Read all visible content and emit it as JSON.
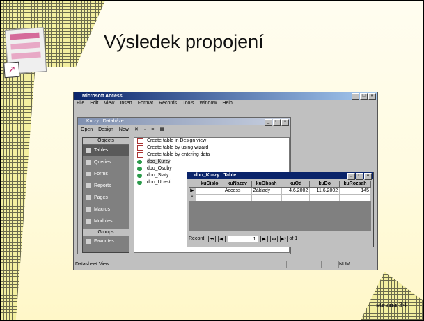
{
  "slide": {
    "title": "Výsledek propojení",
    "page_label": "strana 34",
    "icon_name": "access-logo-icon"
  },
  "access": {
    "app_title": "Microsoft Access",
    "menu": [
      "File",
      "Edit",
      "View",
      "Insert",
      "Format",
      "Records",
      "Tools",
      "Window",
      "Help"
    ],
    "db_window": {
      "title": "Kurzy : Databáze",
      "toolbar": {
        "open": "Open",
        "design": "Design",
        "new": "New"
      },
      "objects_header": "Objects",
      "objects": [
        "Tables",
        "Queries",
        "Forms",
        "Reports",
        "Pages",
        "Macros",
        "Modules"
      ],
      "selected_object": "Tables",
      "groups_header": "Groups",
      "groups": [
        "Favorites"
      ],
      "list": [
        {
          "label": "Create table in Design view",
          "kind": "wizard"
        },
        {
          "label": "Create table by using wizard",
          "kind": "wizard"
        },
        {
          "label": "Create table by entering data",
          "kind": "wizard"
        },
        {
          "label": "dbo_Kurzy",
          "kind": "table"
        },
        {
          "label": "dbo_Osoby",
          "kind": "table"
        },
        {
          "label": "dbo_Staty",
          "kind": "table"
        },
        {
          "label": "dbo_Ucasti",
          "kind": "table"
        }
      ],
      "highlighted": "dbo_Kurzy"
    },
    "table_window": {
      "title": "dbo_Kurzy : Table",
      "columns": [
        "kuCislo",
        "kuNazev",
        "kuObsah",
        "kuOd",
        "kuDo",
        "kuRozsah"
      ],
      "rows": [
        [
          "",
          "Access",
          "Základy",
          "4.6.2002",
          "11.6.2002",
          "145"
        ]
      ],
      "record_label": "Record:",
      "record_value": "1",
      "record_total": "of 1"
    },
    "status_bar": {
      "left": "Datasheet View",
      "num": "NUM"
    }
  }
}
